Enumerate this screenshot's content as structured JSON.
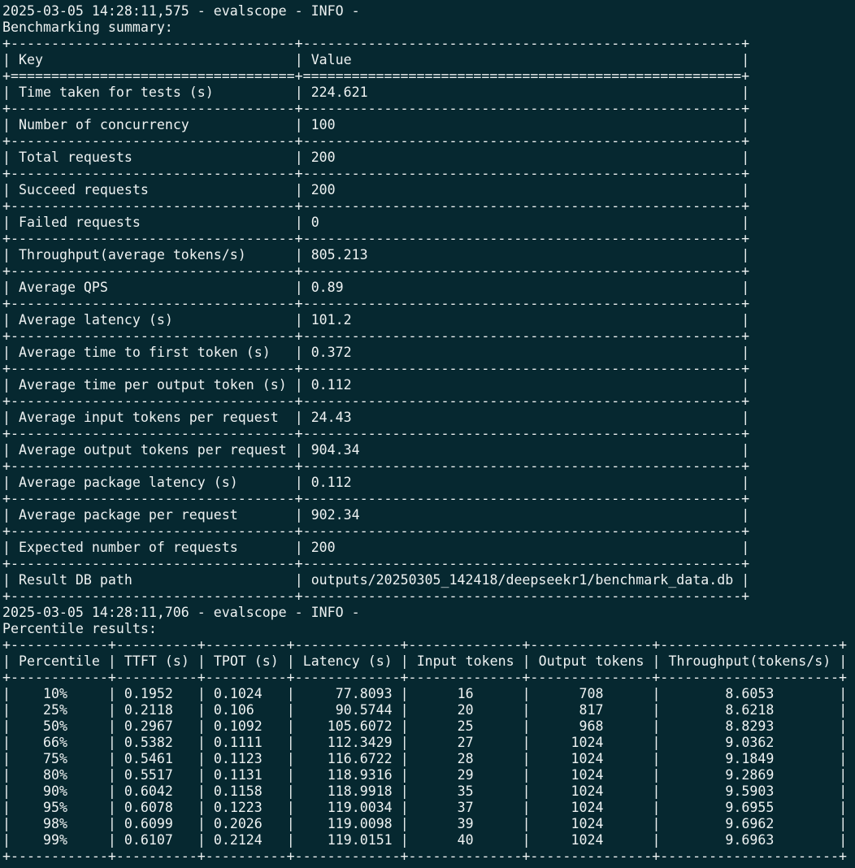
{
  "log1": {
    "header": "2025-03-05 14:28:11,575 - evalscope - INFO -",
    "title": "Benchmarking summary:"
  },
  "summary": {
    "columns": [
      "Key",
      "Value"
    ],
    "rows": [
      [
        "Time taken for tests (s)",
        "224.621"
      ],
      [
        "Number of concurrency",
        "100"
      ],
      [
        "Total requests",
        "200"
      ],
      [
        "Succeed requests",
        "200"
      ],
      [
        "Failed requests",
        "0"
      ],
      [
        "Throughput(average tokens/s)",
        "805.213"
      ],
      [
        "Average QPS",
        "0.89"
      ],
      [
        "Average latency (s)",
        "101.2"
      ],
      [
        "Average time to first token (s)",
        "0.372"
      ],
      [
        "Average time per output token (s)",
        "0.112"
      ],
      [
        "Average input tokens per request",
        "24.43"
      ],
      [
        "Average output tokens per request",
        "904.34"
      ],
      [
        "Average package latency (s)",
        "0.112"
      ],
      [
        "Average package per request",
        "902.34"
      ],
      [
        "Expected number of requests",
        "200"
      ],
      [
        "Result DB path",
        "outputs/20250305_142418/deepseekr1/benchmark_data.db"
      ]
    ]
  },
  "log2": {
    "header": "2025-03-05 14:28:11,706 - evalscope - INFO -",
    "title": "Percentile results:"
  },
  "percentiles": {
    "columns": [
      "Percentile",
      "TTFT (s)",
      "TPOT (s)",
      "Latency (s)",
      "Input tokens",
      "Output tokens",
      "Throughput(tokens/s)"
    ],
    "rows": [
      [
        "10%",
        "0.1952",
        "0.1024",
        "77.8093",
        "16",
        "708",
        "8.6053"
      ],
      [
        "25%",
        "0.2118",
        "0.106",
        "90.5744",
        "20",
        "817",
        "8.6218"
      ],
      [
        "50%",
        "0.2967",
        "0.1092",
        "105.6072",
        "25",
        "968",
        "8.8293"
      ],
      [
        "66%",
        "0.5382",
        "0.1111",
        "112.3429",
        "27",
        "1024",
        "9.0362"
      ],
      [
        "75%",
        "0.5461",
        "0.1123",
        "116.6722",
        "28",
        "1024",
        "9.1849"
      ],
      [
        "80%",
        "0.5517",
        "0.1131",
        "118.9316",
        "29",
        "1024",
        "9.2869"
      ],
      [
        "90%",
        "0.6042",
        "0.1158",
        "118.9918",
        "35",
        "1024",
        "9.5903"
      ],
      [
        "95%",
        "0.6078",
        "0.1223",
        "119.0034",
        "37",
        "1024",
        "9.6955"
      ],
      [
        "98%",
        "0.6099",
        "0.2026",
        "119.0098",
        "39",
        "1024",
        "9.6962"
      ],
      [
        "99%",
        "0.6107",
        "0.2124",
        "119.0151",
        "40",
        "1024",
        "9.6963"
      ]
    ]
  },
  "colors": {
    "background": "#062830",
    "foreground": "#eef2f2"
  }
}
